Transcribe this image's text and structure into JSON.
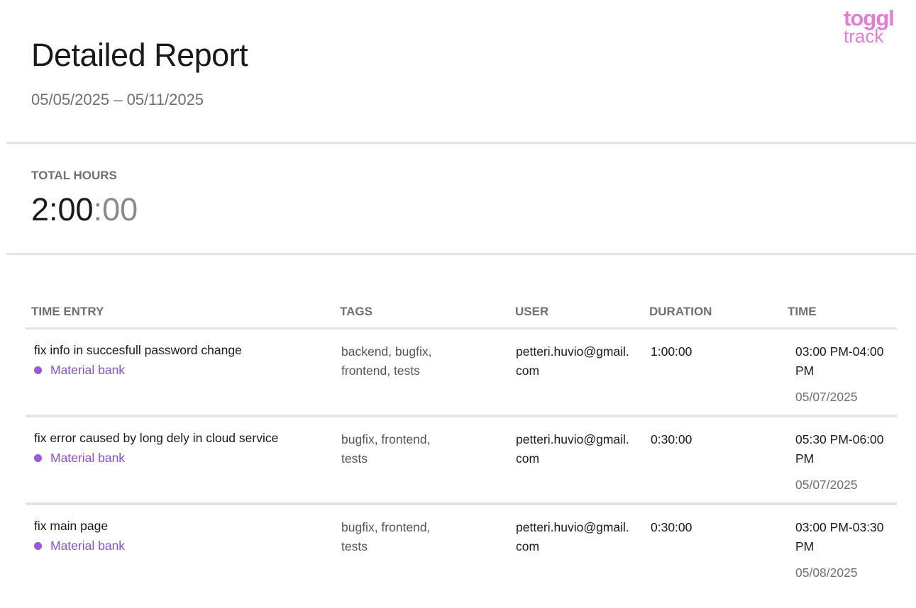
{
  "brand": {
    "logo_top": "toggl",
    "logo_bottom": "track",
    "color": "#e57cd8"
  },
  "report": {
    "title": "Detailed Report",
    "date_range": "05/05/2025 – 05/11/2025"
  },
  "totals": {
    "label": "TOTAL HOURS",
    "value_main": "2:00",
    "value_seconds": ":00"
  },
  "table": {
    "headers": {
      "time_entry": "TIME ENTRY",
      "tags": "TAGS",
      "user": "USER",
      "duration": "DURATION",
      "time": "TIME"
    },
    "project_color": "#9c58d8",
    "rows": [
      {
        "description": "fix info in succesfull password change",
        "project": "Material bank",
        "tags": "backend, bugfix, frontend, tests",
        "user": "petteri.huvio@gmail.com",
        "duration": "1:00:00",
        "time_range": "03:00 PM-04:00 PM",
        "date": "05/07/2025"
      },
      {
        "description": "fix error caused by long dely in cloud service",
        "project": "Material bank",
        "tags": "bugfix, frontend, tests",
        "user": "petteri.huvio@gmail.com",
        "duration": "0:30:00",
        "time_range": "05:30 PM-06:00 PM",
        "date": "05/07/2025"
      },
      {
        "description": "fix main page",
        "project": "Material bank",
        "tags": "bugfix, frontend, tests",
        "user": "petteri.huvio@gmail.com",
        "duration": "0:30:00",
        "time_range": "03:00 PM-03:30 PM",
        "date": "05/08/2025"
      }
    ]
  }
}
